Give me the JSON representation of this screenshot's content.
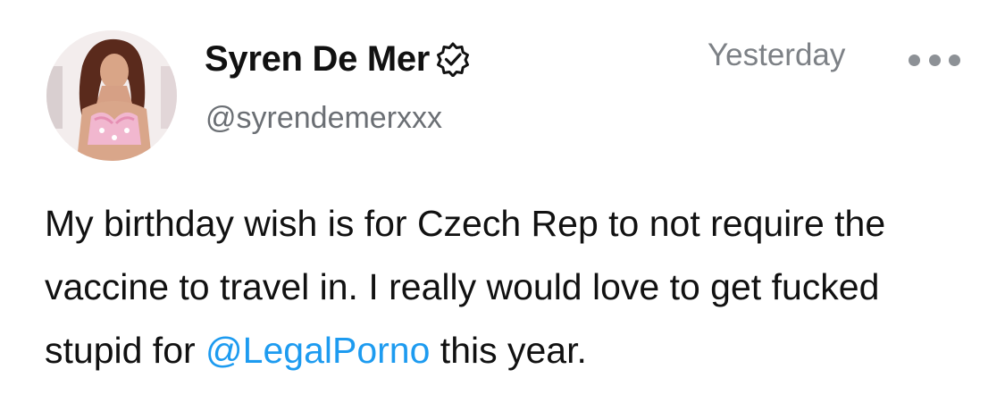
{
  "author": {
    "display_name": "Syren De Mer",
    "handle": "@syrendemerxxx",
    "verified_icon": "verified-badge-icon"
  },
  "timestamp": "Yesterday",
  "more_icon": "more-options-icon",
  "post": {
    "text_before": "My birthday wish is for Czech Rep to not require the vaccine to travel in. I really would love to get fucked stupid for ",
    "mention": "@LegalPorno",
    "text_after": " this year."
  },
  "colors": {
    "mention": "#1d9bf0",
    "secondary_text": "#6b6f74",
    "primary_text": "#111111"
  }
}
